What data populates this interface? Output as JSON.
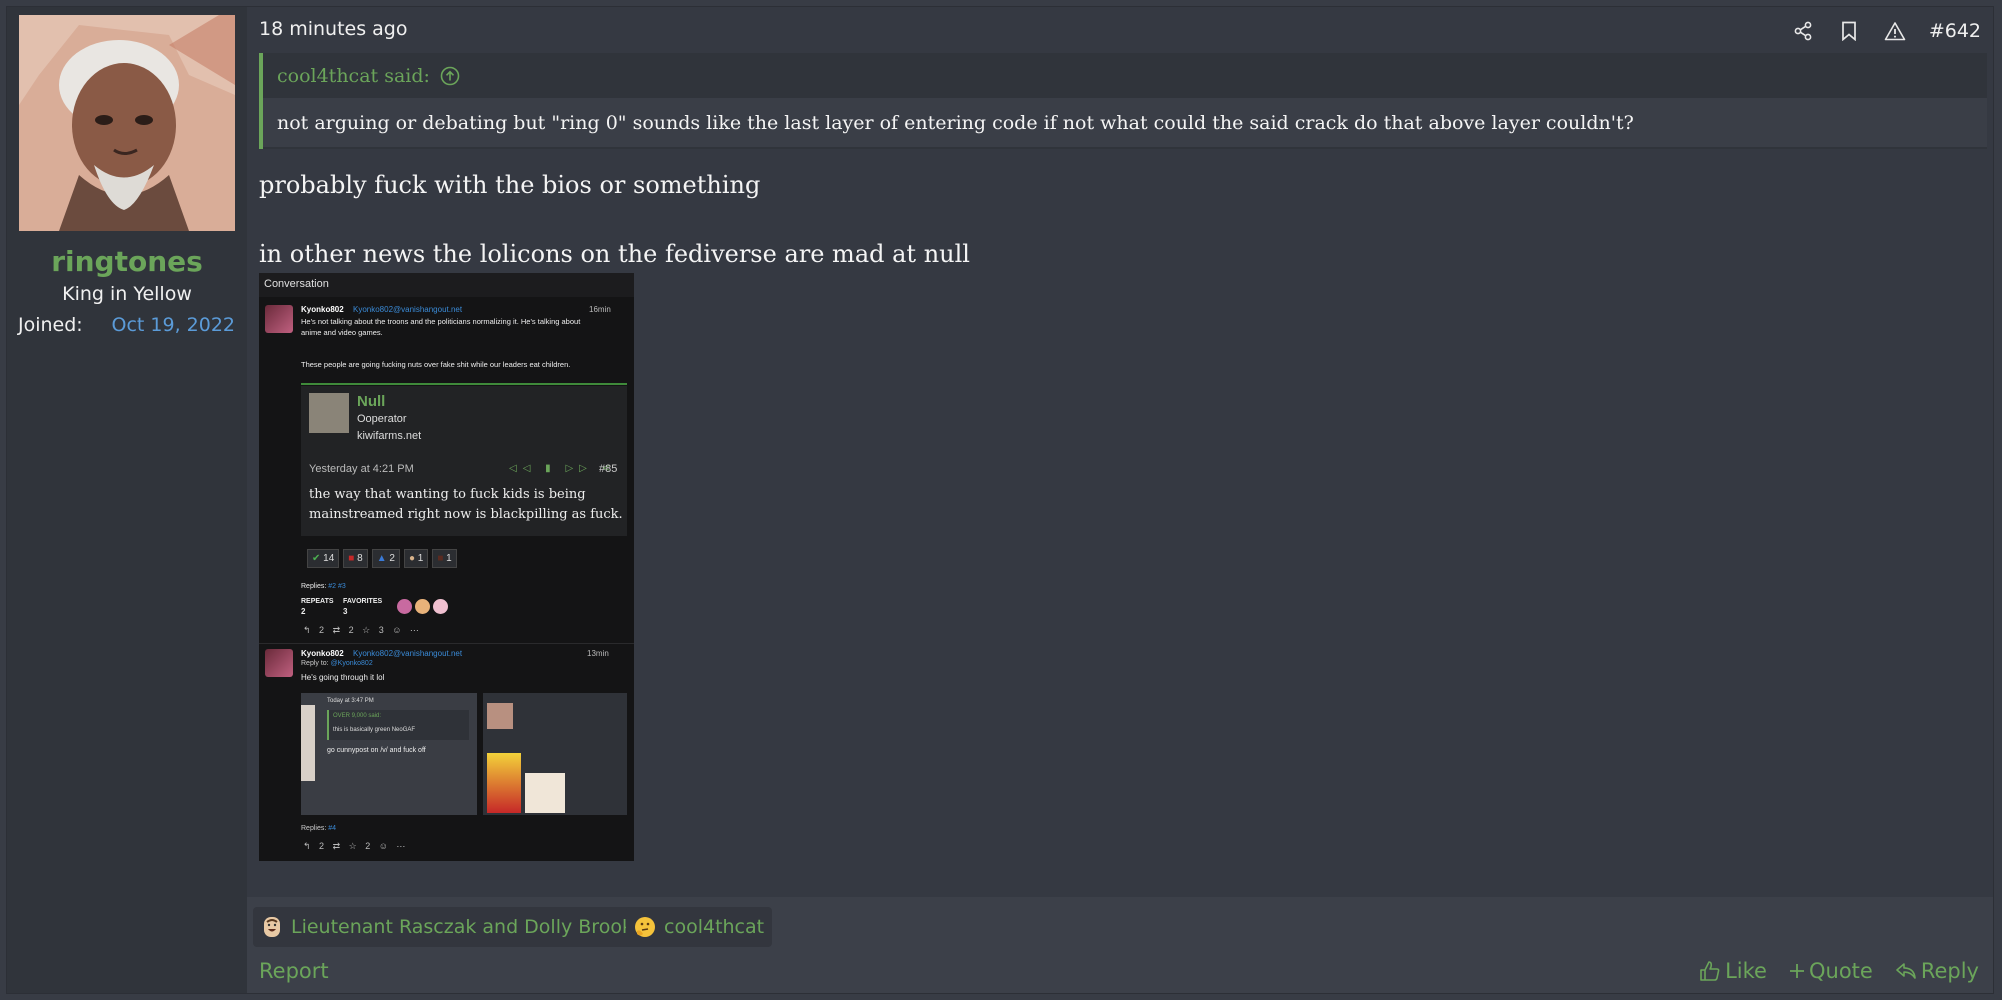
{
  "user": {
    "username": "ringtones",
    "title": "King in Yellow",
    "joined_label": "Joined:",
    "joined_date": "Oct 19, 2022"
  },
  "post": {
    "time": "18 minutes ago",
    "number": "#642",
    "quote": {
      "author": "cool4thcat said:",
      "text": "not arguing or debating but \"ring 0\" sounds like the last layer of entering code if not what could the said crack do that above layer couldn't?"
    },
    "message": {
      "line1": "probably fuck with the bios or something",
      "line2": "in other news the lolicons on the fediverse are mad at null"
    }
  },
  "embed": {
    "header": "Conversation",
    "post1": {
      "username": "Kyonko802",
      "handle": "Kyonko802@vanishangout.net",
      "time": "16min",
      "text1": "He's not talking about the troons and the politicians normalizing it. He's talking about",
      "text2": "anime and video games.",
      "text3": "These people are going fucking nuts over fake shit while our leaders eat children.",
      "quoted": {
        "name": "Null",
        "role": "Ooperator",
        "site": "kiwifarms.net",
        "time": "Yesterday at 4:21 PM",
        "number": "#85",
        "text1": "the way that wanting to fuck kids is being",
        "text2": "mainstreamed right now is blackpilling as fuck.",
        "reactions": [
          "14",
          "8",
          "2",
          "1",
          "1"
        ]
      },
      "replies_label": "Replies:",
      "replies_value": "#2 #3",
      "repeats_label": "REPEATS",
      "repeats_value": "2",
      "favorites_label": "FAVORITES",
      "favorites_value": "3",
      "stats": [
        "2",
        "2",
        "3"
      ]
    },
    "post2": {
      "username": "Kyonko802",
      "handle": "Kyonko802@vanishangout.net",
      "time": "13min",
      "reply_to": "Reply to:",
      "reply_handle": "@Kyonko802",
      "text": "He's going through it lol",
      "inner_time": "Today at 3:47 PM",
      "inner_said": "OVER 9,000 said:",
      "inner_quote": "this is basically green NeoGAF",
      "inner_text": "go cunnypost on /v/ and fuck off",
      "replies_label": "Replies:",
      "replies_value": "#4",
      "stats": [
        "2",
        "2"
      ]
    }
  },
  "reactions": [
    {
      "label": "Lieutenant Rasczak and Dolly Brooks",
      "icon": "laughing-face-icon"
    },
    {
      "label": "cool4thcat",
      "icon": "thinking-face-icon"
    }
  ],
  "actions": {
    "report": "Report",
    "like": "Like",
    "quote": "Quote",
    "reply": "Reply"
  },
  "colors": {
    "accent_green": "#6ba55a",
    "link_blue": "#5b9bd8",
    "background": "#383c45"
  }
}
